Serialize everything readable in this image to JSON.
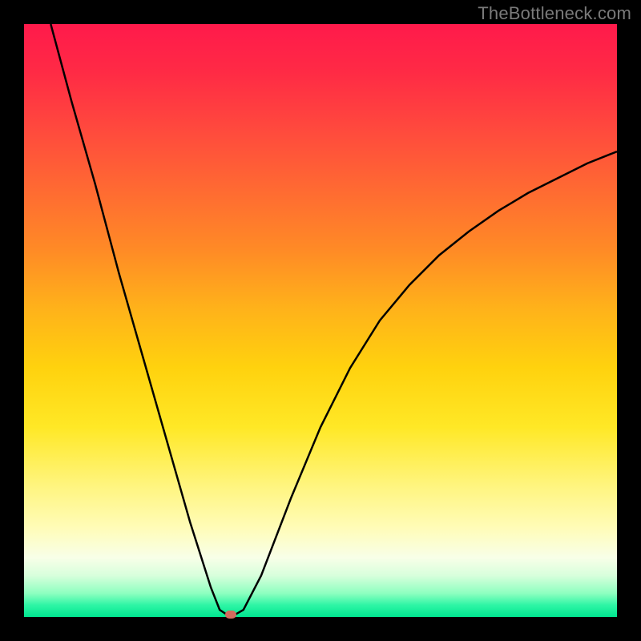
{
  "attribution": "TheBottleneck.com",
  "colors": {
    "page_bg": "#000000",
    "gradient_top": "#ff1a4b",
    "gradient_bottom": "#00e690",
    "curve_stroke": "#000000",
    "marker_fill": "#d46a5e",
    "attribution_text": "#7a7a7a"
  },
  "chart_data": {
    "type": "line",
    "title": "",
    "xlabel": "",
    "ylabel": "",
    "xlim": [
      0,
      100
    ],
    "ylim": [
      0,
      100
    ],
    "legend": false,
    "grid": false,
    "series": [
      {
        "name": "bottleneck-curve",
        "points": [
          {
            "x": 4.5,
            "y": 100
          },
          {
            "x": 8,
            "y": 87
          },
          {
            "x": 12,
            "y": 73
          },
          {
            "x": 16,
            "y": 58
          },
          {
            "x": 20,
            "y": 44
          },
          {
            "x": 24,
            "y": 30
          },
          {
            "x": 28,
            "y": 16
          },
          {
            "x": 31.5,
            "y": 5
          },
          {
            "x": 33,
            "y": 1.2
          },
          {
            "x": 34.2,
            "y": 0.4
          },
          {
            "x": 35.6,
            "y": 0.4
          },
          {
            "x": 37,
            "y": 1.2
          },
          {
            "x": 40,
            "y": 7
          },
          {
            "x": 45,
            "y": 20
          },
          {
            "x": 50,
            "y": 32
          },
          {
            "x": 55,
            "y": 42
          },
          {
            "x": 60,
            "y": 50
          },
          {
            "x": 65,
            "y": 56
          },
          {
            "x": 70,
            "y": 61
          },
          {
            "x": 75,
            "y": 65
          },
          {
            "x": 80,
            "y": 68.5
          },
          {
            "x": 85,
            "y": 71.5
          },
          {
            "x": 90,
            "y": 74
          },
          {
            "x": 95,
            "y": 76.5
          },
          {
            "x": 100,
            "y": 78.5
          }
        ]
      }
    ],
    "annotations": [
      {
        "name": "optimal-marker",
        "x": 34.9,
        "y": 0.4
      }
    ]
  }
}
